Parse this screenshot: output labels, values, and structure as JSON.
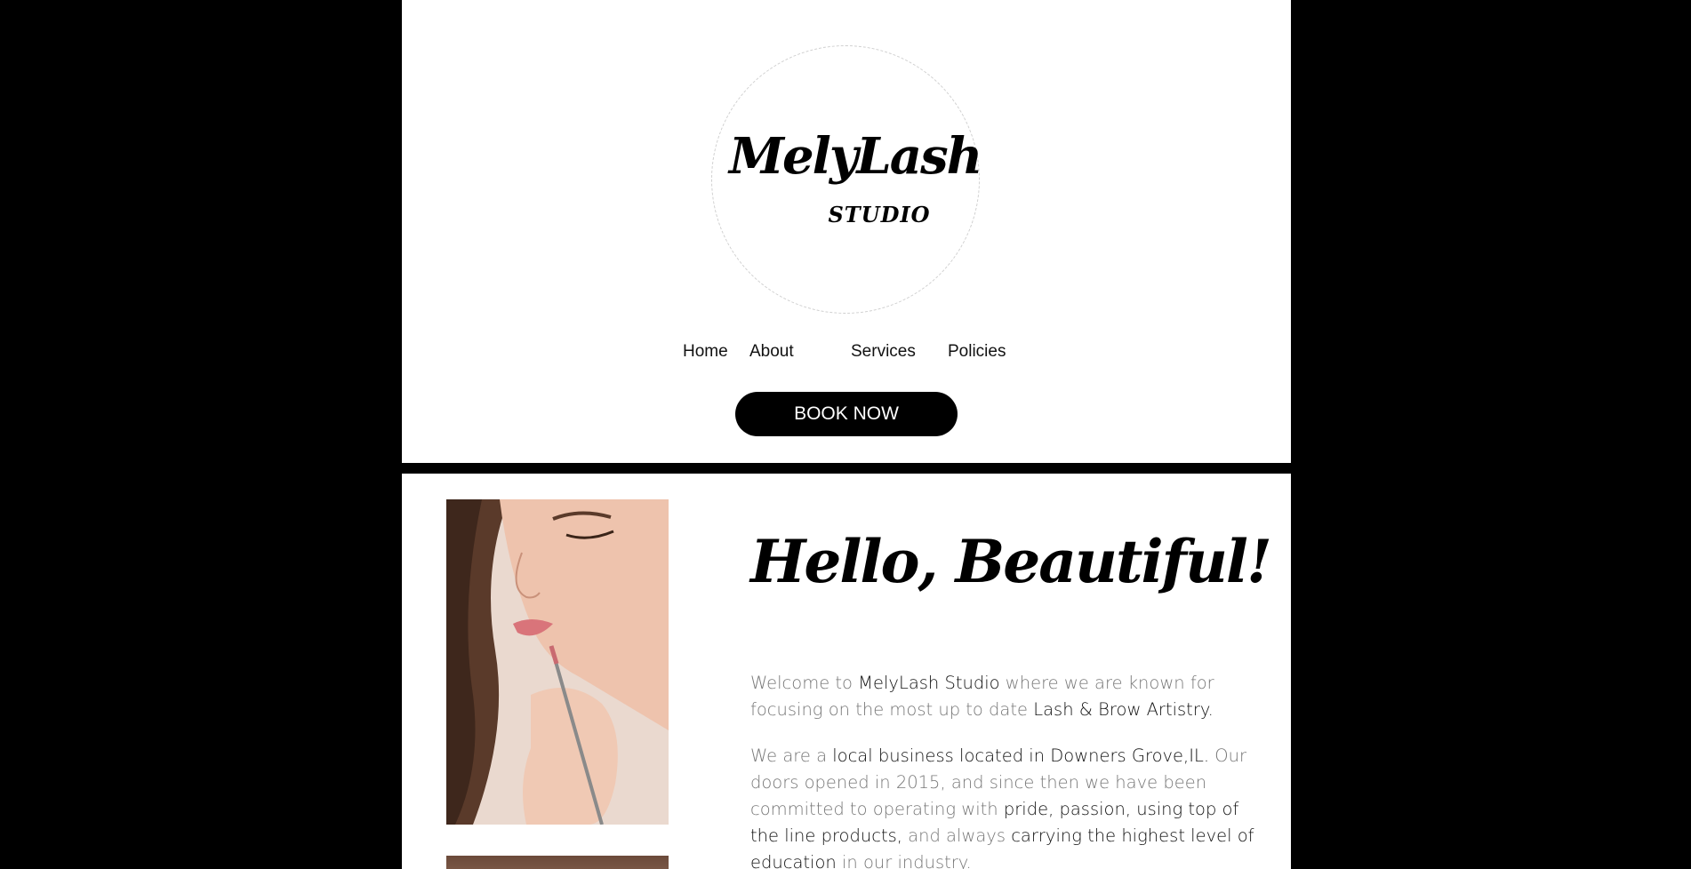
{
  "brand": {
    "name": "MelyLash",
    "subtitle": "STUDIO"
  },
  "nav": {
    "items": [
      {
        "label": "Home"
      },
      {
        "label": "About"
      },
      {
        "label": "Services"
      },
      {
        "label": "Policies"
      }
    ]
  },
  "cta": {
    "book_label": "BOOK NOW"
  },
  "main": {
    "heading": "Hello, Beautiful!",
    "para1": {
      "t1": "Welcome to ",
      "e1": "MelyLash Studio",
      "t2": " where we are known for focusing on the most up to date ",
      "e2": "Lash & Brow Artistry."
    },
    "para2": {
      "t1": "We are a ",
      "e1": "local business located in Downers Grove,IL.",
      "t2": " Our doors opened in 2015, and since then we have been committed to operating with ",
      "e2": "pride, passion, using top of the line products,",
      "t3": " and always ",
      "e3": "carrying the highest level of education",
      "t4": " in our industry."
    }
  },
  "colors": {
    "background": "#000000",
    "panel": "#ffffff",
    "accent": "#000000",
    "body_text": "#777777",
    "emphasis_text": "#111111"
  }
}
